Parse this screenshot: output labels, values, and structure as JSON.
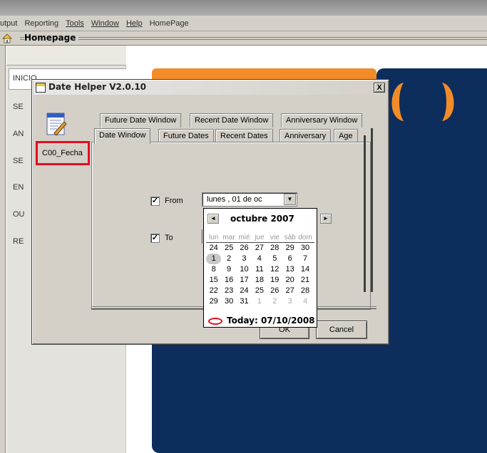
{
  "menubar": {
    "items": [
      "utput",
      "Reporting",
      "Tools",
      "Window",
      "Help",
      "HomePage"
    ]
  },
  "homepage": {
    "title": "Homepage"
  },
  "sidebar": {
    "items": [
      "INICIO",
      "SE",
      "AN",
      "SE",
      "EN",
      "OU",
      "RE"
    ]
  },
  "dialog": {
    "title": "Date Helper V2.0.10",
    "close_label": "X",
    "app_label": "C00_Fecha",
    "tabs_back": [
      "Future Date Window",
      "Recent Date Window",
      "Anniversary Window"
    ],
    "tabs_front": [
      "Date Window",
      "Future Dates",
      "Recent Dates",
      "Anniversary",
      "Age"
    ],
    "from_check": "✓",
    "from_label": "From",
    "from_value": "lunes , 01 de oc",
    "to_check": "✓",
    "to_label": "To",
    "ok_label": "OK",
    "cancel_label": "Cancel"
  },
  "calendar": {
    "month_label": "octubre 2007",
    "prev": "◄",
    "next": "►",
    "weekdays": [
      "lun",
      "mar",
      "mié",
      "jue",
      "vie",
      "sáb",
      "dom"
    ],
    "weeks": [
      [
        "24",
        "25",
        "26",
        "27",
        "28",
        "29",
        "30"
      ],
      [
        "1",
        "2",
        "3",
        "4",
        "5",
        "6",
        "7"
      ],
      [
        "8",
        "9",
        "10",
        "11",
        "12",
        "13",
        "14"
      ],
      [
        "15",
        "16",
        "17",
        "18",
        "19",
        "20",
        "21"
      ],
      [
        "22",
        "23",
        "24",
        "25",
        "26",
        "27",
        "28"
      ],
      [
        "29",
        "30",
        "31",
        "1",
        "2",
        "3",
        "4"
      ]
    ],
    "selected_day": "1",
    "today_label": "Today: 07/10/2008"
  },
  "colors": {
    "orange": "#f28c28",
    "navy": "#0d2d5c",
    "highlight_red": "#e01020"
  }
}
